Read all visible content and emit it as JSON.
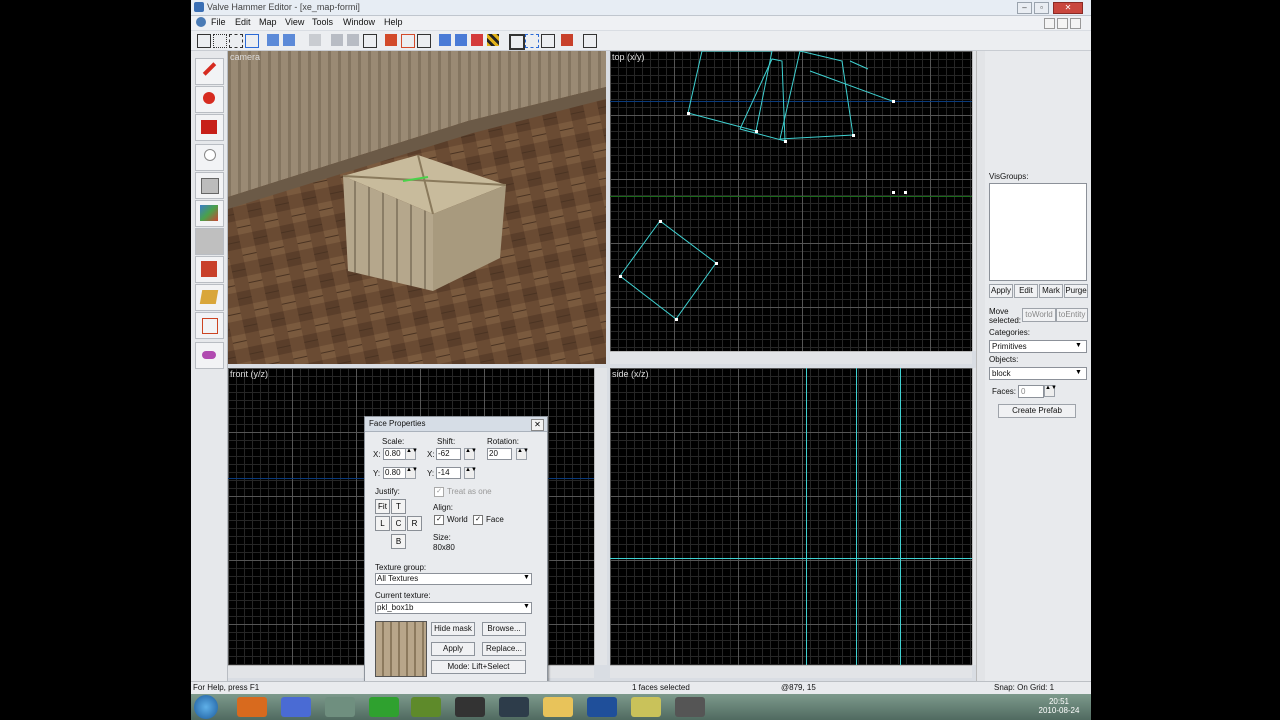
{
  "window": {
    "title": "Valve Hammer Editor - [xe_map-formi]",
    "controls": [
      "–",
      "▫",
      "✕"
    ]
  },
  "menu": [
    "File",
    "Edit",
    "Map",
    "View",
    "Tools",
    "Window",
    "Help"
  ],
  "viewports": {
    "camera": "camera",
    "top": "top (x/y)",
    "front": "front (y/z)",
    "side": "side (x/z)"
  },
  "right_panel": {
    "visgroups_label": "VisGroups:",
    "buttons": [
      "Apply",
      "Edit",
      "Mark",
      "Purge"
    ],
    "move_selected_label": "Move selected:",
    "to_world": "toWorld",
    "to_entity": "toEntity",
    "categories_label": "Categories:",
    "categories_value": "Primitives",
    "objects_label": "Objects:",
    "objects_value": "block",
    "faces_label": "Faces:",
    "faces_value": "0",
    "create_prefab": "Create Prefab"
  },
  "face_properties": {
    "title": "Face Properties",
    "scale_label": "Scale:",
    "shift_label": "Shift:",
    "rotation_label": "Rotation:",
    "x_label": "X:",
    "y_label": "Y:",
    "scale_x": "0.80",
    "scale_y": "0.80",
    "shift_x": "-62",
    "shift_y": "-14",
    "rotation": "20",
    "treat_as_one": "Treat as one",
    "justify_label": "Justify:",
    "justify_buttons": [
      "Fit",
      "T",
      "L",
      "C",
      "R",
      "B"
    ],
    "align_label": "Align:",
    "align_world": "World",
    "align_face": "Face",
    "size_label": "Size:",
    "size_value": "80x80",
    "texture_group_label": "Texture group:",
    "texture_group_value": "All Textures",
    "current_texture_label": "Current texture:",
    "current_texture_value": "pkl_box1b",
    "hide_mask": "Hide mask",
    "browse": "Browse...",
    "apply": "Apply",
    "replace": "Replace...",
    "mode": "Mode: Lift+Select"
  },
  "status_bar": {
    "help": "For Help, press F1",
    "selection": "1 faces selected",
    "coords": "@879, 15",
    "snap": "Snap: On Grid: 1"
  },
  "taskbar": {
    "time": "20:51",
    "date": "2010-08-24"
  },
  "colors": {
    "selection_line": "#3fd1d1",
    "grid_major": "#555555",
    "axis_blue": "#0a3a7a"
  }
}
